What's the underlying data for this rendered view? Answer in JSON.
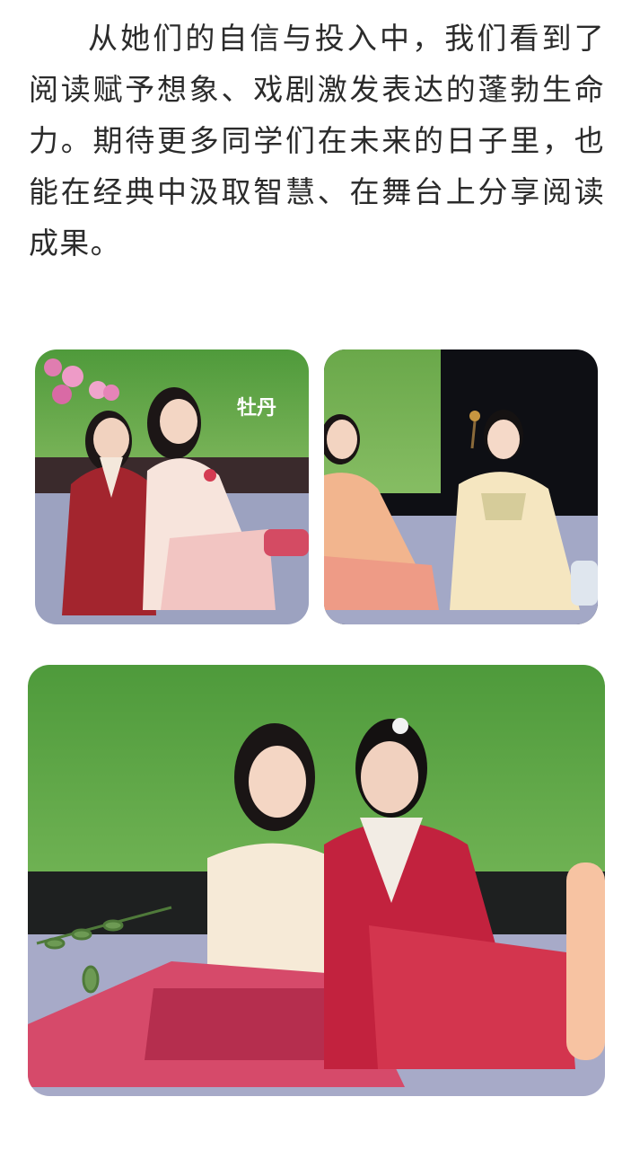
{
  "article": {
    "paragraph": "从她们的自信与投入中，我们看到了阅读赋予想象、戏剧激发表达的蓬勃生命力。期待更多同学们在未来的日子里，也能在经典中汲取智慧、在舞台上分享阅读成果。"
  },
  "photos": {
    "photo_1": {
      "screen_caption": "牡丹"
    }
  },
  "colors": {
    "text": "#2b2b2b",
    "background": "#ffffff",
    "screen_green": "#5fa043",
    "stage_floor": "#9aa0bd",
    "costume_red": "#a3252e"
  }
}
